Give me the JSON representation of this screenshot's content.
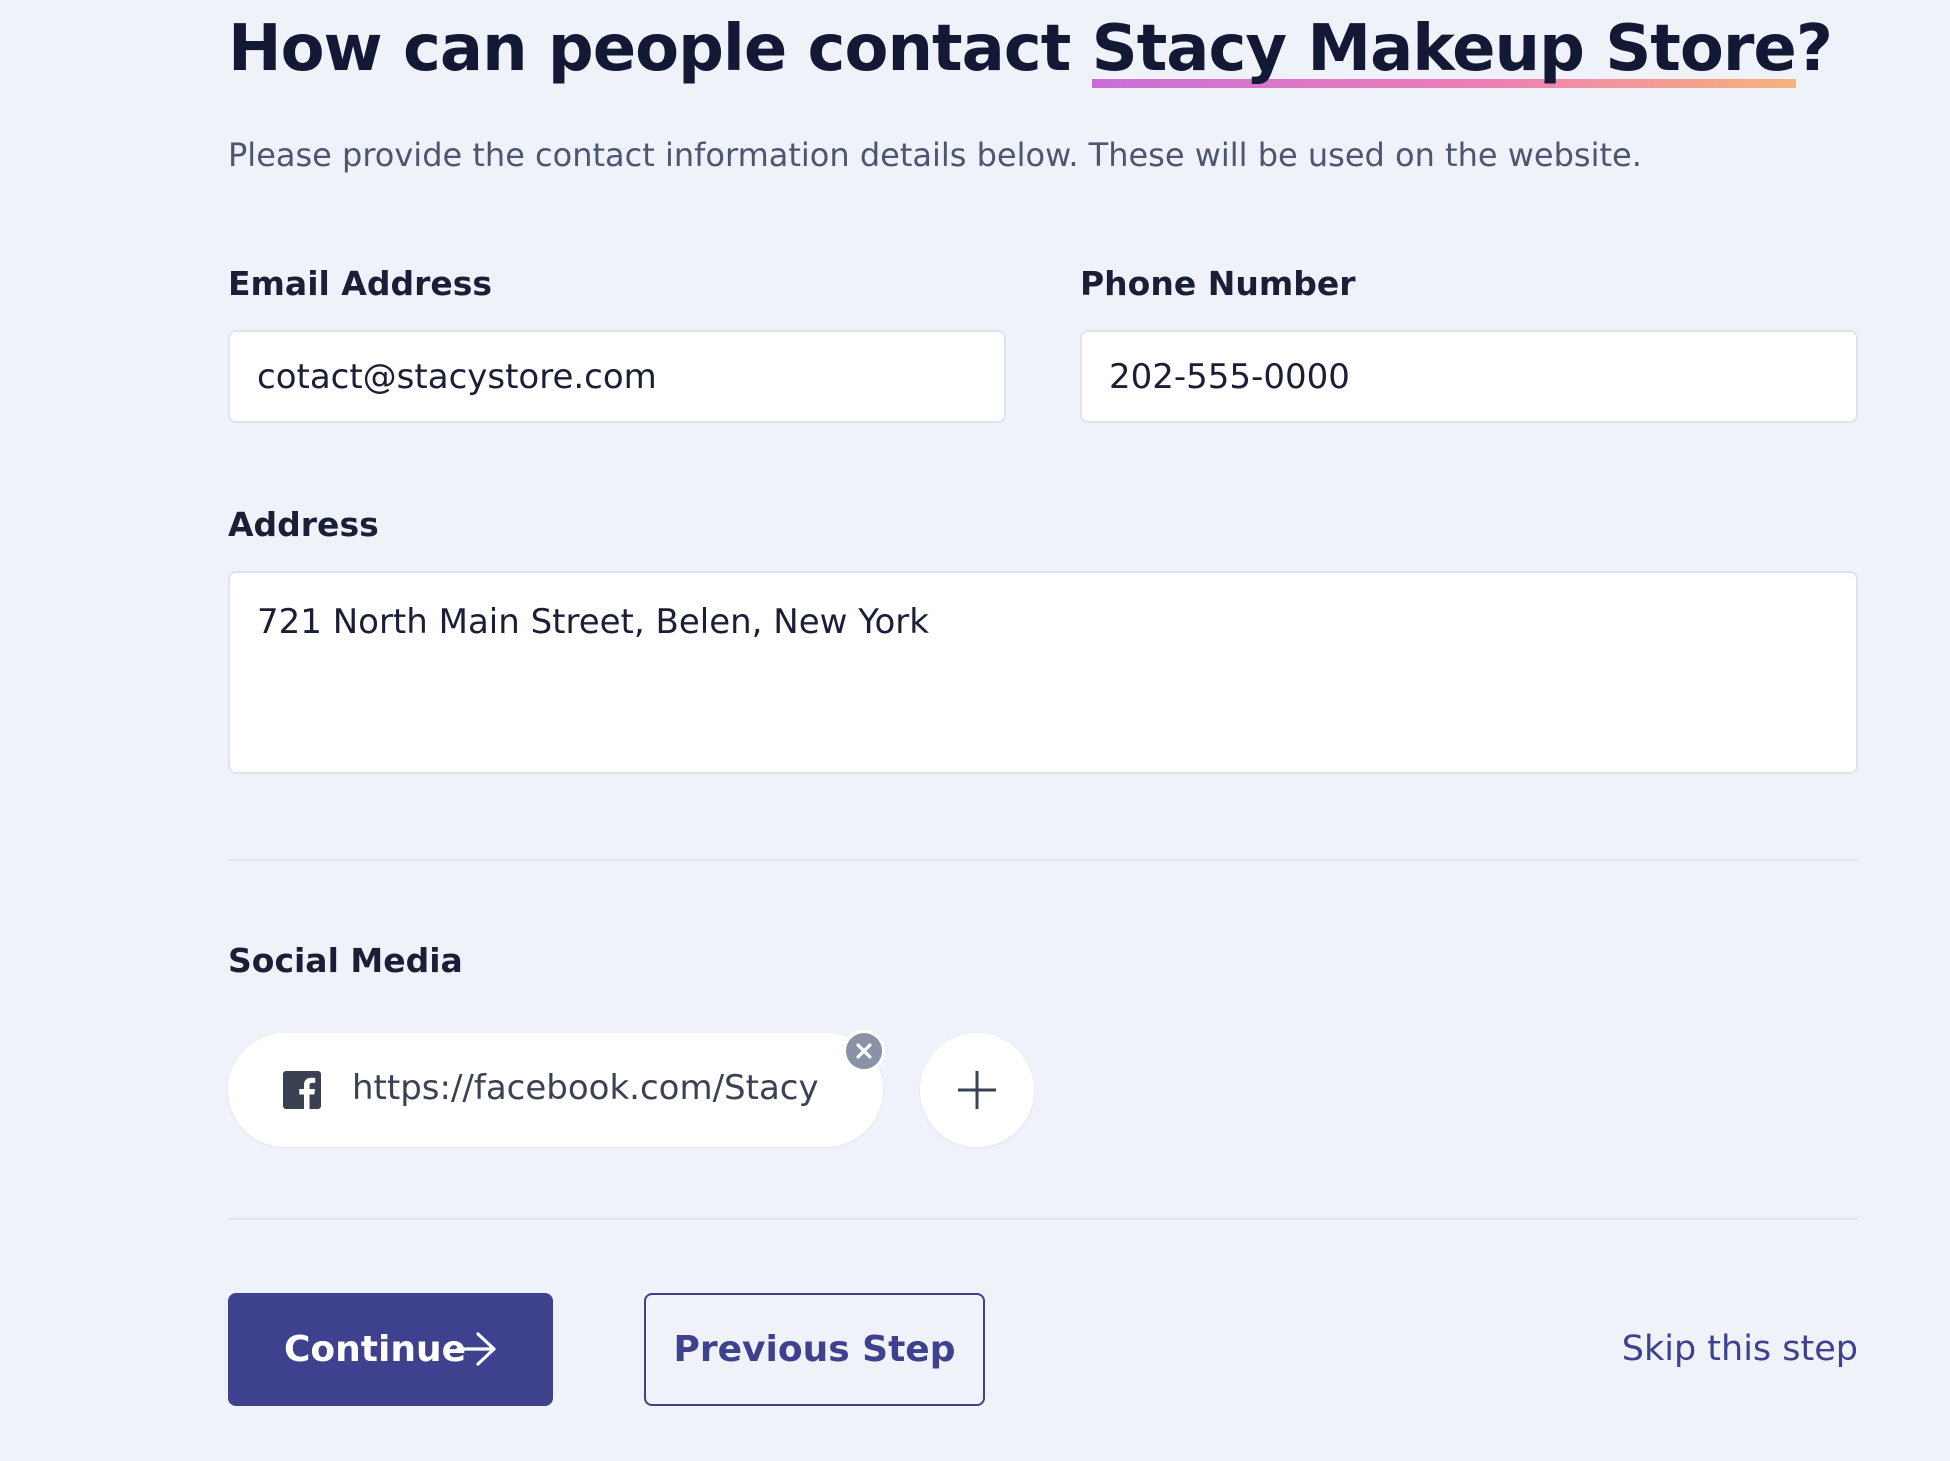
{
  "header": {
    "title_prefix": "How can people contact ",
    "business_name": "Stacy Makeup Store",
    "title_suffix": "?",
    "subtitle": "Please provide the contact information details below. These will be used on the website."
  },
  "form": {
    "email": {
      "label": "Email Address",
      "value": "cotact@stacystore.com"
    },
    "phone": {
      "label": "Phone Number",
      "value": "202-555-0000"
    },
    "address": {
      "label": "Address",
      "value": "721 North Main Street, Belen, New York"
    }
  },
  "social": {
    "label": "Social Media",
    "items": [
      {
        "icon": "facebook-icon",
        "url": "https://facebook.com/Stacy"
      }
    ]
  },
  "actions": {
    "continue_label": "Continue",
    "previous_label": "Previous Step",
    "skip_label": "Skip this step"
  },
  "colors": {
    "background": "#f0f2fa",
    "primary": "#3d418e",
    "heading": "#131834",
    "underline_gradient": [
      "#c86fd6",
      "#ee7eb6",
      "#f7b27c"
    ]
  }
}
